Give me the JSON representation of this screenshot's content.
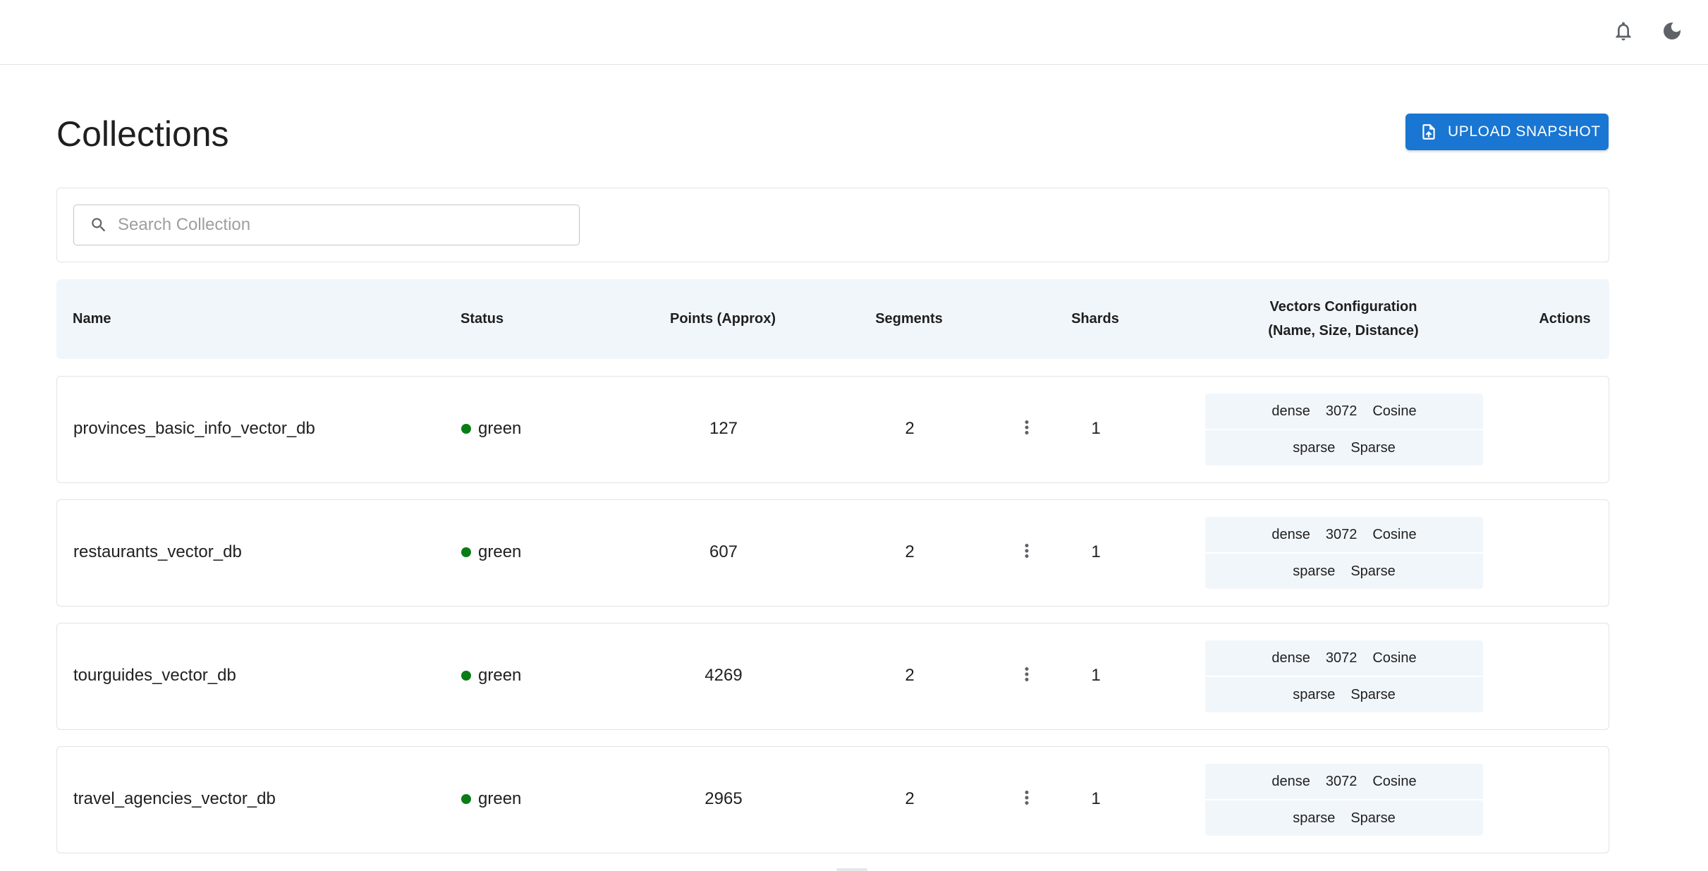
{
  "header": {
    "icons": {
      "notifications": "bell-icon",
      "theme": "moon-icon"
    }
  },
  "page": {
    "title": "Collections",
    "upload_button": {
      "label": "UPLOAD SNAPSHOT",
      "icon": "file-upload-icon",
      "color": "#1976d2"
    }
  },
  "search": {
    "placeholder": "Search Collection",
    "value": "",
    "icon": "search-icon"
  },
  "table": {
    "columns": {
      "name": "Name",
      "status": "Status",
      "points": "Points (Approx)",
      "segments": "Segments",
      "shards": "Shards",
      "vectors_line1": "Vectors Configuration",
      "vectors_line2": "(Name, Size, Distance)",
      "actions": "Actions"
    },
    "rows": [
      {
        "name": "provinces_basic_info_vector_db",
        "status": "green",
        "points": "127",
        "segments": "2",
        "shards": "1",
        "vectors": [
          {
            "name": "dense",
            "size": "3072",
            "distance": "Cosine"
          },
          {
            "name": "sparse",
            "distance": "Sparse"
          }
        ]
      },
      {
        "name": "restaurants_vector_db",
        "status": "green",
        "points": "607",
        "segments": "2",
        "shards": "1",
        "vectors": [
          {
            "name": "dense",
            "size": "3072",
            "distance": "Cosine"
          },
          {
            "name": "sparse",
            "distance": "Sparse"
          }
        ]
      },
      {
        "name": "tourguides_vector_db",
        "status": "green",
        "points": "4269",
        "segments": "2",
        "shards": "1",
        "vectors": [
          {
            "name": "dense",
            "size": "3072",
            "distance": "Cosine"
          },
          {
            "name": "sparse",
            "distance": "Sparse"
          }
        ]
      },
      {
        "name": "travel_agencies_vector_db",
        "status": "green",
        "points": "2965",
        "segments": "2",
        "shards": "1",
        "vectors": [
          {
            "name": "dense",
            "size": "3072",
            "distance": "Cosine"
          },
          {
            "name": "sparse",
            "distance": "Sparse"
          }
        ]
      }
    ]
  },
  "colors": {
    "status_green": "#0a7d16",
    "header_bg": "#f1f6fb",
    "accent": "#1976d2"
  }
}
